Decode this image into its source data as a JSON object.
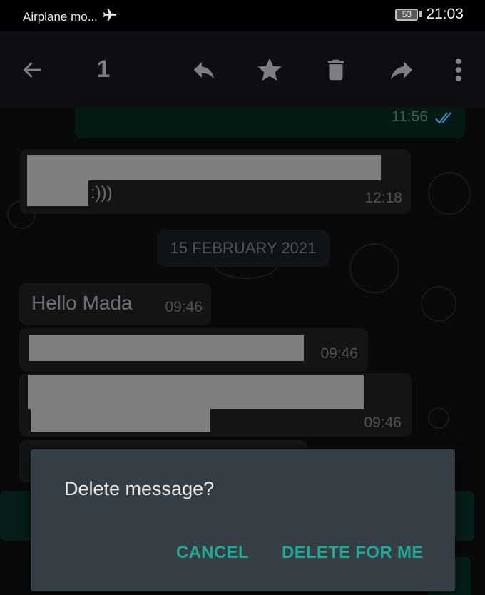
{
  "status_bar": {
    "network_label": "Airplane mo...",
    "airplane_icon": "airplane-icon",
    "battery_level": "53",
    "clock": "21:03"
  },
  "action_bar": {
    "back_icon": "arrow-left-icon",
    "selected_count": "1",
    "actions": [
      {
        "name": "reply",
        "icon": "reply-icon"
      },
      {
        "name": "star",
        "icon": "star-icon"
      },
      {
        "name": "delete",
        "icon": "trash-icon"
      },
      {
        "name": "forward",
        "icon": "forward-icon"
      },
      {
        "name": "more",
        "icon": "more-vertical-icon"
      }
    ]
  },
  "chat": {
    "messages": [
      {
        "direction": "outgoing",
        "text": "",
        "time": "11:56",
        "status": "read",
        "redacted": false
      },
      {
        "direction": "incoming",
        "text": ":)))",
        "time": "12:18",
        "redacted": true
      },
      {
        "direction": "incoming",
        "text": "Hello Mada",
        "time": "09:46",
        "redacted": false
      },
      {
        "direction": "incoming",
        "text": "",
        "time": "09:46",
        "redacted": true
      },
      {
        "direction": "incoming",
        "text": "",
        "time": "09:46",
        "redacted": true
      }
    ],
    "date_separator": "15 FEBRUARY 2021"
  },
  "dialog": {
    "title": "Delete message?",
    "cancel_label": "CANCEL",
    "confirm_label": "DELETE FOR ME"
  },
  "colors": {
    "accent": "#21a796",
    "read_ticks": "#3b8fc4",
    "dialog_bg": "#353e44",
    "toolbar_icon": "#7d7f82"
  }
}
